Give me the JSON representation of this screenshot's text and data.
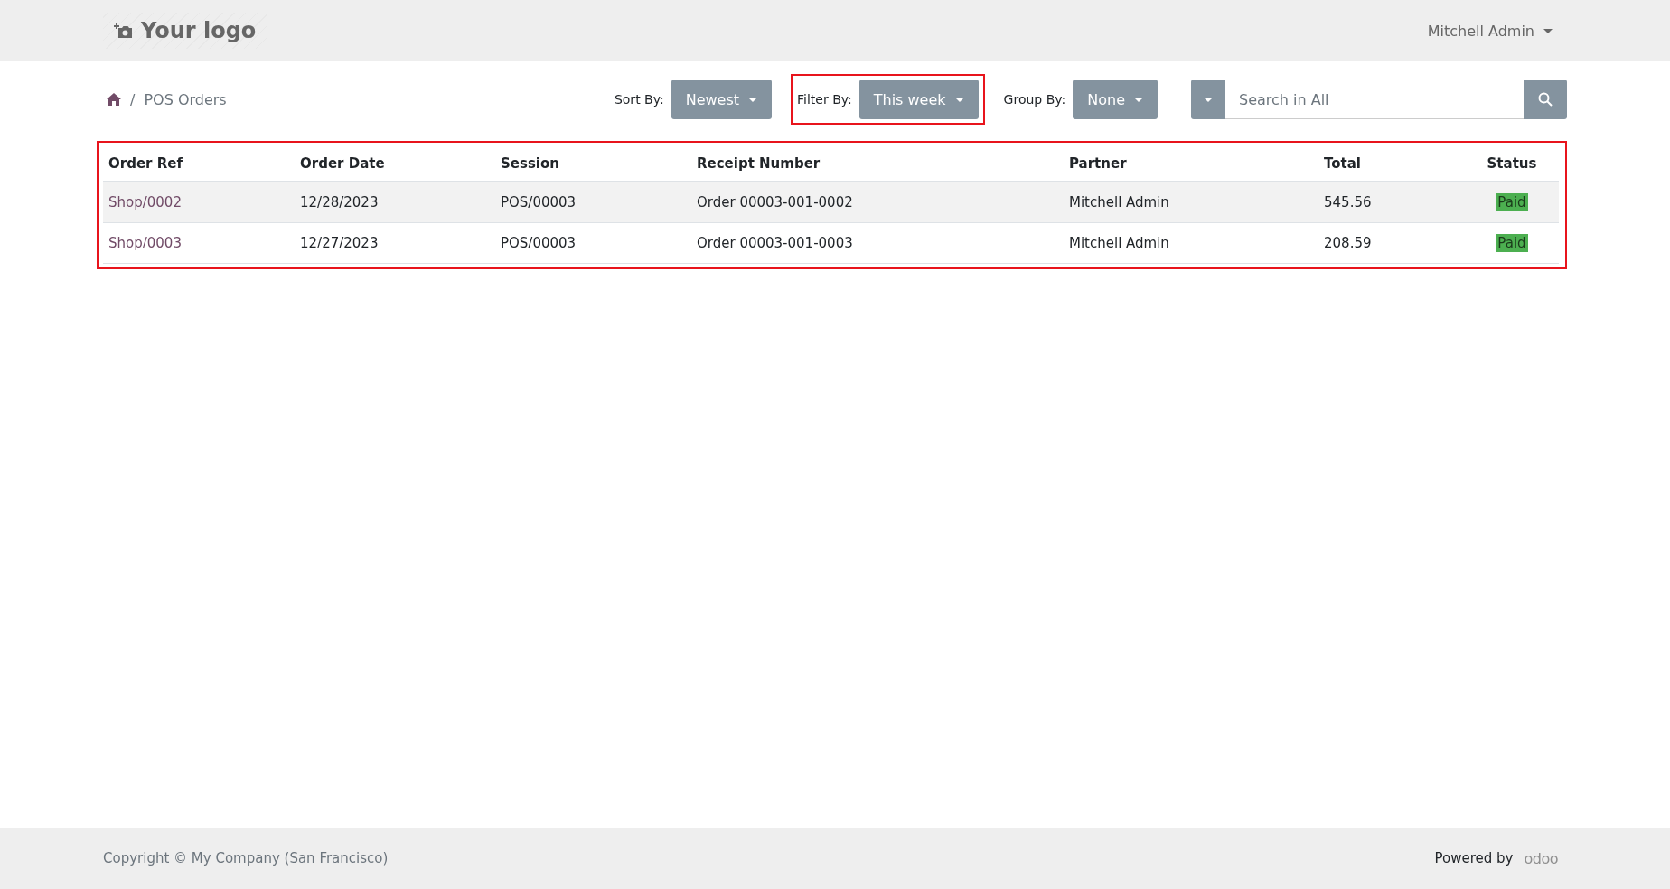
{
  "header": {
    "logo": "Your logo",
    "user": "Mitchell Admin"
  },
  "breadcrumb": {
    "separator": "/",
    "items": [
      "POS Orders"
    ]
  },
  "toolbar": {
    "controls": [
      {
        "label": "Sort By:",
        "value": "Newest",
        "highlighted": false
      },
      {
        "label": "Filter By:",
        "value": "This week",
        "highlighted": true
      },
      {
        "label": "Group By:",
        "value": "None",
        "highlighted": false
      }
    ],
    "search": {
      "placeholder": "Search in All"
    }
  },
  "table": {
    "highlighted": true,
    "columns": [
      "Order Ref",
      "Order Date",
      "Session",
      "Receipt Number",
      "Partner",
      "Total",
      "Status"
    ],
    "rows": [
      {
        "cells": [
          "Shop/0002",
          "12/28/2023",
          "POS/00003",
          "Order 00003-001-0002",
          "Mitchell Admin",
          "545.56"
        ],
        "status": {
          "label": "Paid",
          "color": "#4caf50"
        }
      },
      {
        "cells": [
          "Shop/0003",
          "12/27/2023",
          "POS/00003",
          "Order 00003-001-0003",
          "Mitchell Admin",
          "208.59"
        ],
        "status": {
          "label": "Paid",
          "color": "#4caf50"
        }
      }
    ]
  },
  "footer": {
    "copyright": "Copyright © My Company (San Francisco)",
    "powered_by": "Powered by",
    "brand": "odoo"
  }
}
